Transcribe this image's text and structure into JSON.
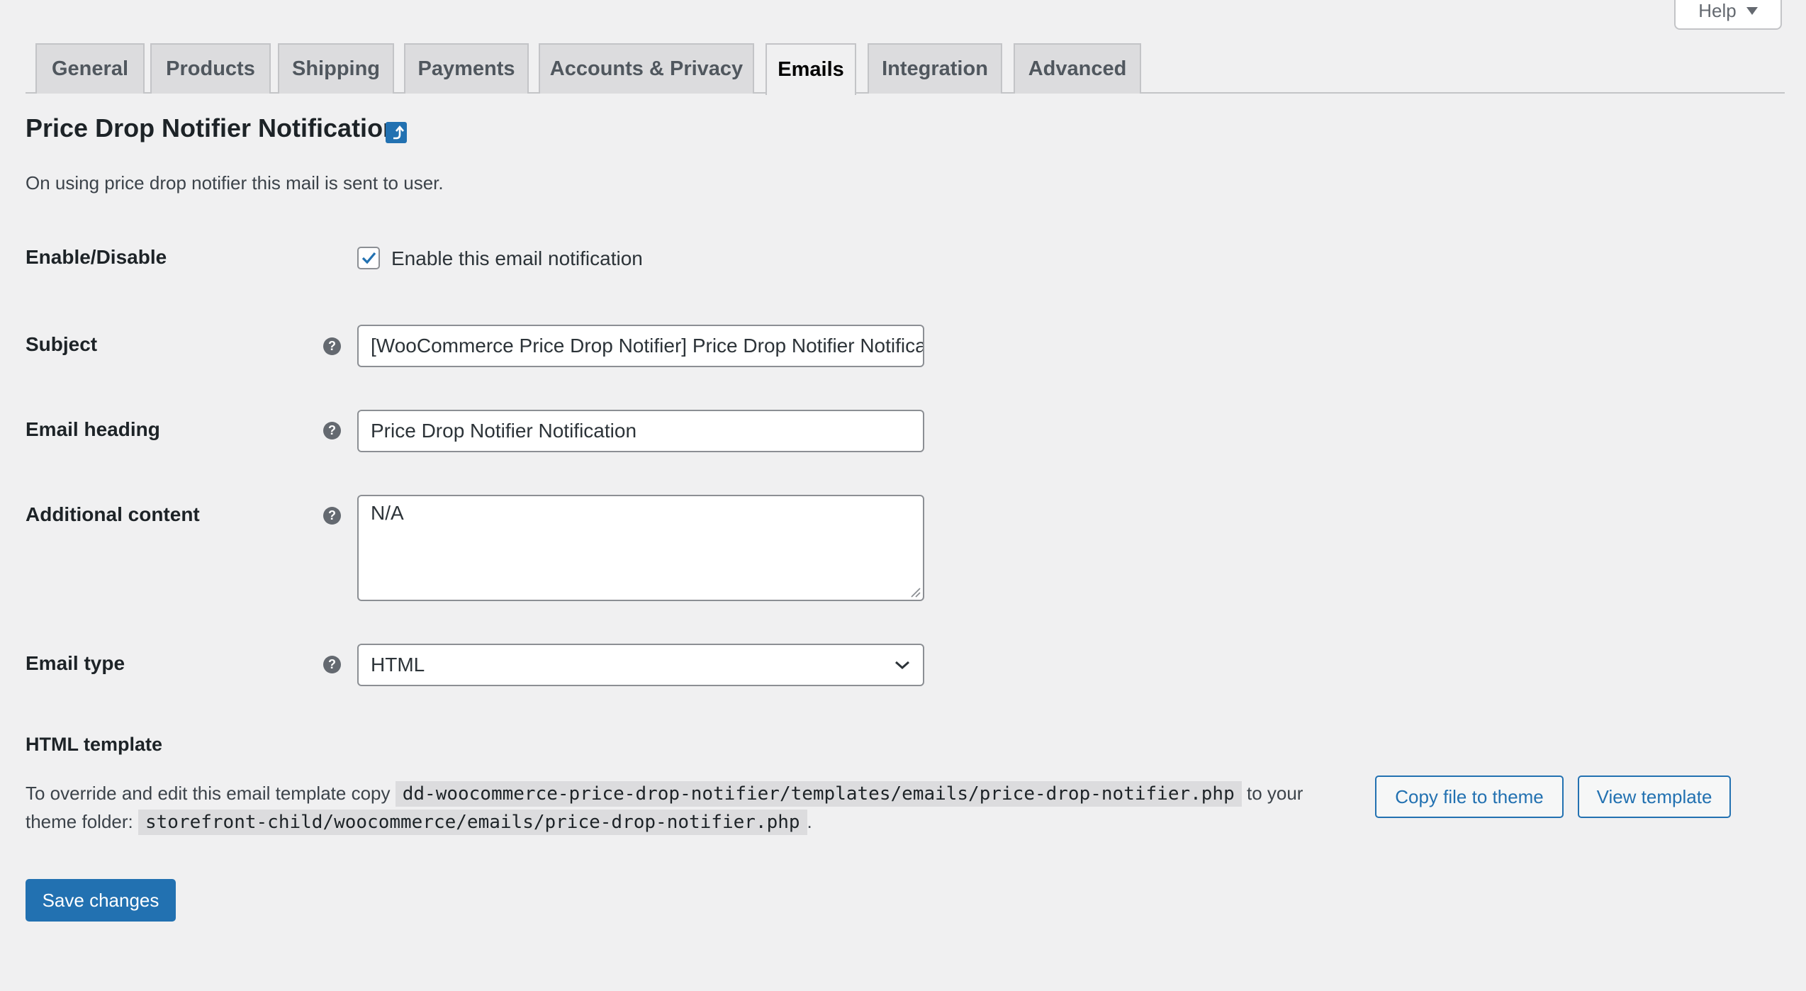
{
  "help": {
    "label": "Help"
  },
  "tabs": [
    {
      "label": "General"
    },
    {
      "label": "Products"
    },
    {
      "label": "Shipping"
    },
    {
      "label": "Payments"
    },
    {
      "label": "Accounts & Privacy"
    },
    {
      "label": "Emails",
      "active": true
    },
    {
      "label": "Integration"
    },
    {
      "label": "Advanced"
    }
  ],
  "page": {
    "title": "Price Drop Notifier Notification",
    "description": "On using price drop notifier this mail is sent to user."
  },
  "form": {
    "enable": {
      "label": "Enable/Disable",
      "checkbox_label": "Enable this email notification",
      "checked": true
    },
    "subject": {
      "label": "Subject",
      "value": "[WooCommerce Price Drop Notifier] Price Drop Notifier Notification"
    },
    "email_heading": {
      "label": "Email heading",
      "value": "Price Drop Notifier Notification"
    },
    "additional_content": {
      "label": "Additional content",
      "value": "N/A"
    },
    "email_type": {
      "label": "Email type",
      "value": "HTML"
    },
    "tip_glyph": "?"
  },
  "template": {
    "title": "HTML template",
    "text_before": "To override and edit this email template copy",
    "source_path": "dd-woocommerce-price-drop-notifier/templates/emails/price-drop-notifier.php",
    "text_middle": "to your theme folder:",
    "dest_path": "storefront-child/woocommerce/emails/price-drop-notifier.php",
    "text_after": ".",
    "copy_button": "Copy file to theme",
    "view_button": "View template"
  },
  "save_button": "Save changes",
  "colors": {
    "background": "#f0f0f1",
    "accent": "#2271b1",
    "tab_inactive": "#dcdcde"
  }
}
